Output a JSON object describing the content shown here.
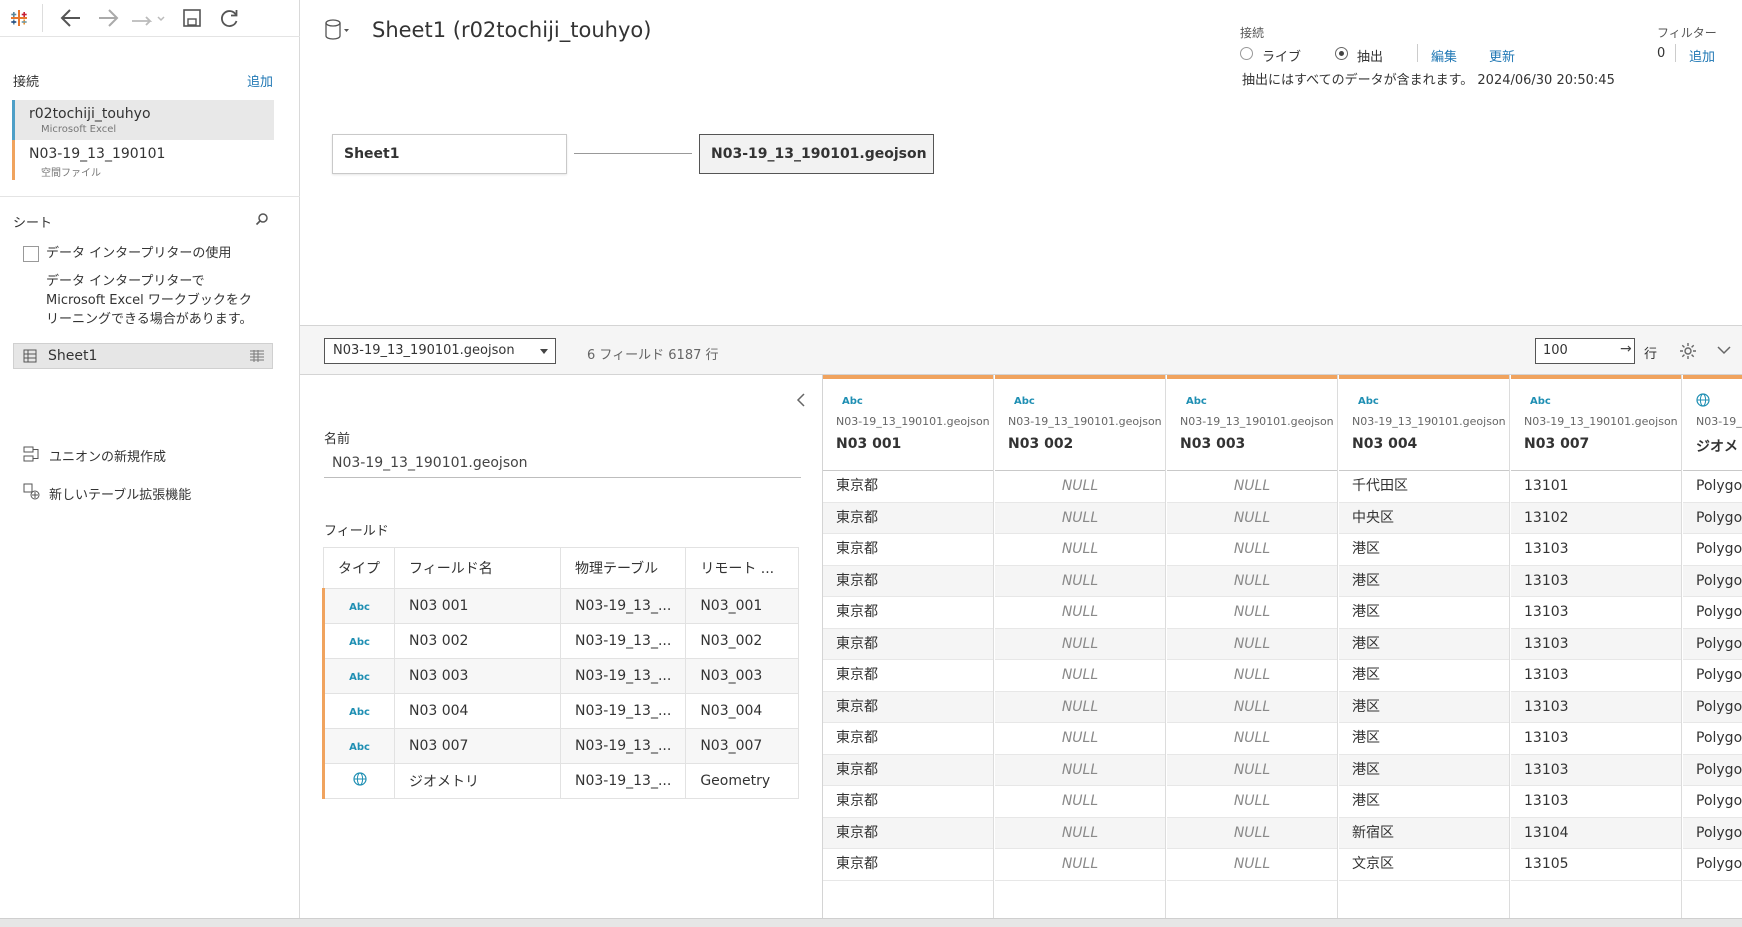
{
  "toolbar": {
    "icons": [
      "tableau-logo-icon",
      "back-icon",
      "forward-icon",
      "redo-icon",
      "save-icon",
      "refresh-icon"
    ]
  },
  "sidebar": {
    "connections_label": "接続",
    "add_label": "追加",
    "connections": [
      {
        "name": "r02tochiji_touhyo",
        "type": "Microsoft Excel",
        "color": "#4e9fc7"
      },
      {
        "name": "N03-19_13_190101",
        "type": "空間ファイル",
        "color": "#f0a35e"
      }
    ],
    "sheets_label": "シート",
    "interpreter_label": "データ インタープリターの使用",
    "interpreter_desc": [
      "データ インタープリターで",
      "Microsoft Excel ワークブックをク",
      "リーニングできる場合があります。"
    ],
    "sheet_item": "Sheet1",
    "new_union": "ユニオンの新規作成",
    "new_table_ext": "新しいテーブル拡張機能"
  },
  "canvas": {
    "title": "Sheet1 (r02tochiji_touhyo)",
    "connection_label": "接続",
    "live_label": "ライブ",
    "extract_label": "抽出",
    "edit_label": "編集",
    "refresh_label": "更新",
    "extract_note": "抽出にはすべてのデータが含まれます。 2024/06/30 20:50:45",
    "filter_label": "フィルター",
    "filter_count": "0",
    "filter_add": "追加",
    "left_table": "Sheet1",
    "right_table": "N03-19_13_190101.geojson"
  },
  "strip": {
    "table_select": "N03-19_13_190101.geojson",
    "summary": "6 フィールド 6187 行",
    "rows_value": "100",
    "rows_label": "行"
  },
  "meta": {
    "name_label": "名前",
    "name_value": "N03-19_13_190101.geojson",
    "fields_label": "フィールド",
    "headers": [
      "タイプ",
      "フィールド名",
      "物理テーブル",
      "リモート ..."
    ],
    "rows": [
      {
        "type": "Abc",
        "name": "N03 001",
        "table": "N03-19_13_...",
        "remote": "N03_001"
      },
      {
        "type": "Abc",
        "name": "N03 002",
        "table": "N03-19_13_...",
        "remote": "N03_002"
      },
      {
        "type": "Abc",
        "name": "N03 003",
        "table": "N03-19_13_...",
        "remote": "N03_003"
      },
      {
        "type": "Abc",
        "name": "N03 004",
        "table": "N03-19_13_...",
        "remote": "N03_004"
      },
      {
        "type": "Abc",
        "name": "N03 007",
        "table": "N03-19_13_...",
        "remote": "N03_007"
      },
      {
        "type": "globe",
        "name": "ジオメトリ",
        "table": "N03-19_13_...",
        "remote": "Geometry"
      }
    ]
  },
  "grid": {
    "columns": [
      {
        "type": "Abc",
        "source": "N03-19_13_190101.geojson",
        "name": "N03 001"
      },
      {
        "type": "Abc",
        "source": "N03-19_13_190101.geojson",
        "name": "N03 002"
      },
      {
        "type": "Abc",
        "source": "N03-19_13_190101.geojson",
        "name": "N03 003"
      },
      {
        "type": "Abc",
        "source": "N03-19_13_190101.geojson",
        "name": "N03 004"
      },
      {
        "type": "Abc",
        "source": "N03-19_13_190101.geojson",
        "name": "N03 007"
      },
      {
        "type": "globe",
        "source": "N03-19_",
        "name": "ジオメ"
      }
    ],
    "rows": [
      [
        "東京都",
        "NULL",
        "NULL",
        "千代田区",
        "13101",
        "Polygo"
      ],
      [
        "東京都",
        "NULL",
        "NULL",
        "中央区",
        "13102",
        "Polygo"
      ],
      [
        "東京都",
        "NULL",
        "NULL",
        "港区",
        "13103",
        "Polygo"
      ],
      [
        "東京都",
        "NULL",
        "NULL",
        "港区",
        "13103",
        "Polygo"
      ],
      [
        "東京都",
        "NULL",
        "NULL",
        "港区",
        "13103",
        "Polygo"
      ],
      [
        "東京都",
        "NULL",
        "NULL",
        "港区",
        "13103",
        "Polygo"
      ],
      [
        "東京都",
        "NULL",
        "NULL",
        "港区",
        "13103",
        "Polygo"
      ],
      [
        "東京都",
        "NULL",
        "NULL",
        "港区",
        "13103",
        "Polygo"
      ],
      [
        "東京都",
        "NULL",
        "NULL",
        "港区",
        "13103",
        "Polygo"
      ],
      [
        "東京都",
        "NULL",
        "NULL",
        "港区",
        "13103",
        "Polygo"
      ],
      [
        "東京都",
        "NULL",
        "NULL",
        "港区",
        "13103",
        "Polygo"
      ],
      [
        "東京都",
        "NULL",
        "NULL",
        "新宿区",
        "13104",
        "Polygo"
      ],
      [
        "東京都",
        "NULL",
        "NULL",
        "文京区",
        "13105",
        "Polygo"
      ]
    ]
  },
  "colors": {
    "accent": "#1f77b4",
    "orange": "#f0a35e",
    "blue_conn": "#4e9fc7"
  }
}
